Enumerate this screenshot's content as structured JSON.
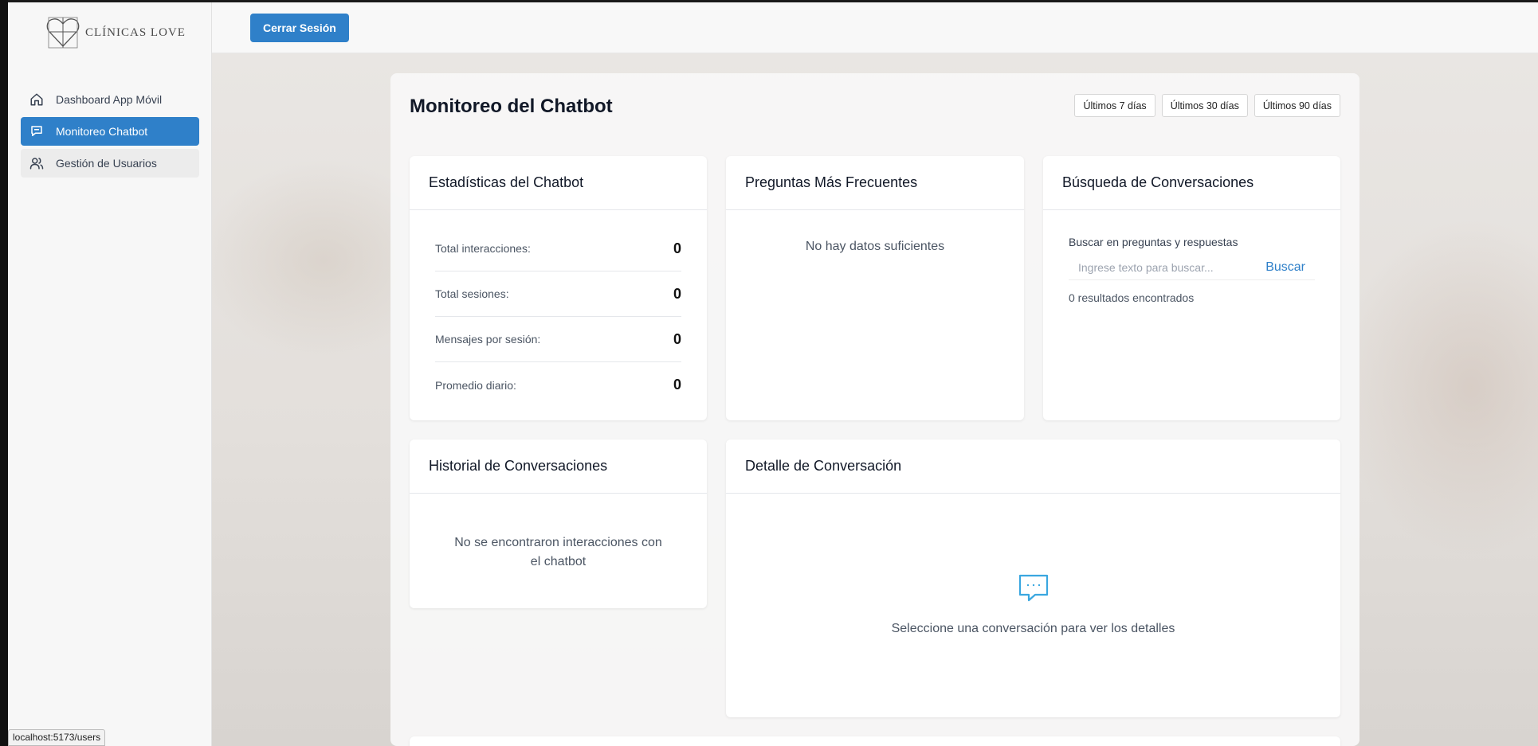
{
  "brand": {
    "logo_text": "CLÍNICAS LOVE"
  },
  "sidebar": {
    "items": [
      {
        "label": "Dashboard App Móvil",
        "icon": "home-icon"
      },
      {
        "label": "Monitoreo Chatbot",
        "icon": "chat-icon",
        "active": true
      },
      {
        "label": "Gestión de Usuarios",
        "icon": "users-icon"
      }
    ]
  },
  "topbar": {
    "logout_label": "Cerrar Sesión"
  },
  "page": {
    "title": "Monitoreo del Chatbot",
    "ranges": [
      "Últimos 7 días",
      "Últimos 30 días",
      "Últimos 90 días"
    ]
  },
  "stats_card": {
    "title": "Estadísticas del Chatbot",
    "rows": [
      {
        "label": "Total interacciones:",
        "value": "0"
      },
      {
        "label": "Total sesiones:",
        "value": "0"
      },
      {
        "label": "Mensajes por sesión:",
        "value": "0"
      },
      {
        "label": "Promedio diario:",
        "value": "0"
      }
    ]
  },
  "faq_card": {
    "title": "Preguntas Más Frecuentes",
    "empty": "No hay datos suficientes"
  },
  "search_card": {
    "title": "Búsqueda de Conversaciones",
    "label": "Buscar en preguntas y respuestas",
    "placeholder": "Ingrese texto para buscar...",
    "button": "Buscar",
    "results": "0 resultados encontrados"
  },
  "history_card": {
    "title": "Historial de Conversaciones",
    "empty_line1": "No se encontraron interacciones con",
    "empty_line2": "el chatbot"
  },
  "detail_card": {
    "title": "Detalle de Conversación",
    "empty": "Seleccione una conversación para ver los detalles"
  },
  "status_bar": {
    "url": "localhost:5173/users"
  },
  "colors": {
    "primary": "#2f80c9",
    "chat_icon": "#3aa7e0"
  }
}
